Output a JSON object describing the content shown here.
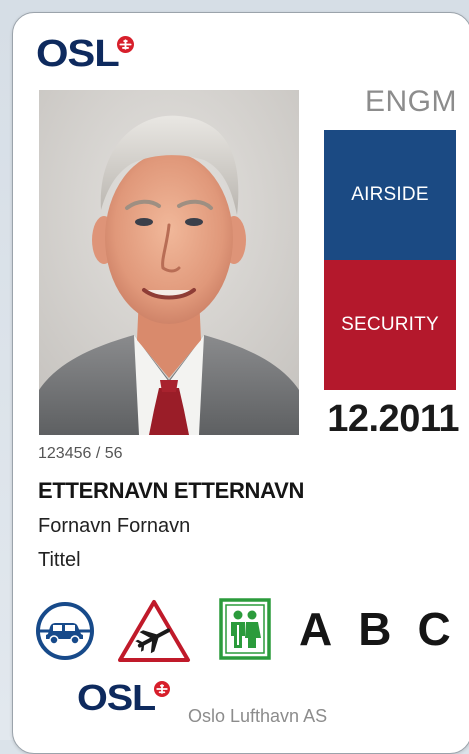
{
  "card": {
    "logo_text": "OSL",
    "airport_code": "ENGM",
    "zones": [
      "AIRSIDE",
      "SECURITY"
    ],
    "expiry": "12.2011",
    "id_number": "123456 / 56",
    "surname": "ETTERNAVN ETTERNAVN",
    "first_name": "Fornavn Fornavn",
    "title": "Tittel",
    "access_letters": [
      "A",
      "B",
      "C"
    ],
    "company": "Oslo Lufthavn AS"
  },
  "icons": {
    "logo": "plane-in-circle-icon",
    "vehicle": "car-in-circle-icon",
    "apron": "airplane-warning-triangle-icon",
    "public": "people-sign-icon"
  },
  "colors": {
    "logo_navy": "#0e2a5e",
    "logo_red": "#d71f2b",
    "airside_blue": "#1b4a83",
    "security_red": "#b4182c",
    "apron_red": "#c01a2a",
    "public_green": "#2b9b3c",
    "vehicle_blue": "#174a8a"
  }
}
